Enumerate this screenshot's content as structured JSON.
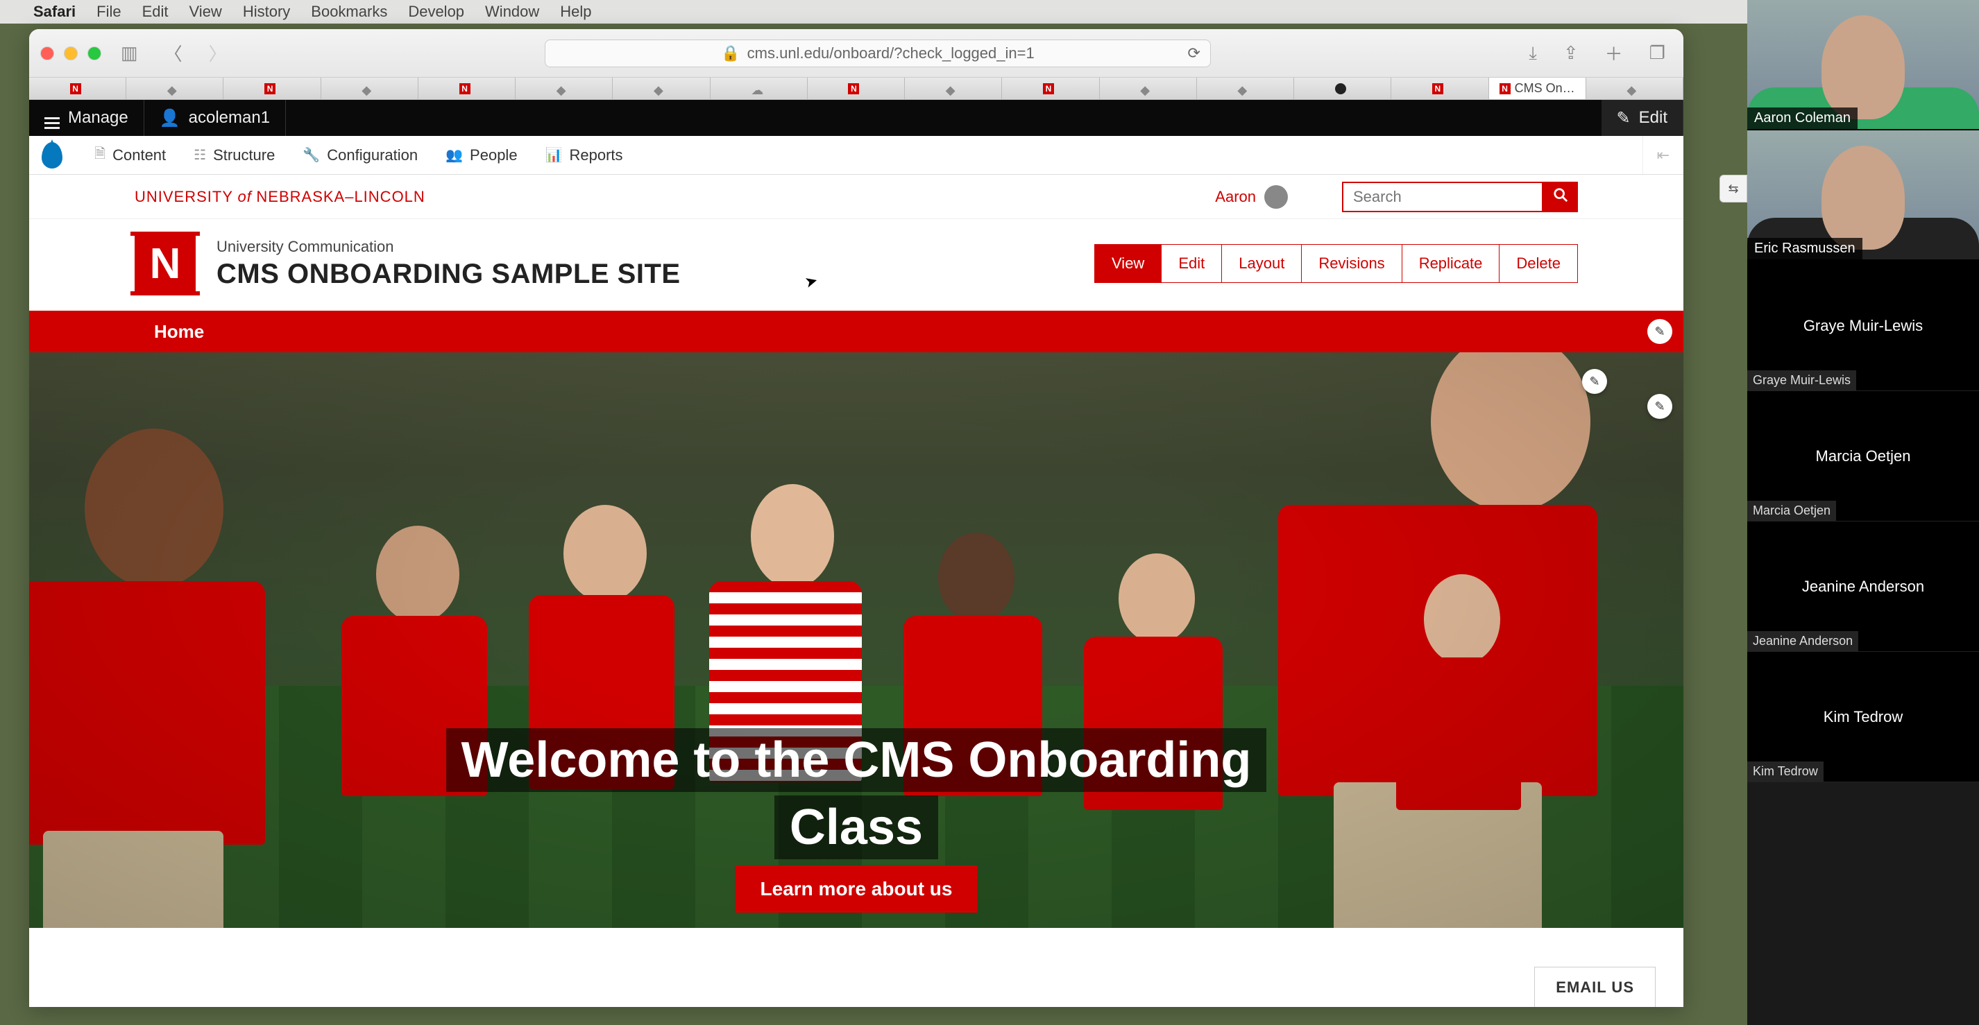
{
  "mac_menu": {
    "app": "Safari",
    "items": [
      "File",
      "Edit",
      "View",
      "History",
      "Bookmarks",
      "Develop",
      "Window",
      "Help"
    ]
  },
  "safari": {
    "url": "cms.unl.edu/onboard/?check_logged_in=1",
    "active_tab_label": "CMS On…"
  },
  "drupal_top": {
    "manage": "Manage",
    "user": "acoleman1",
    "edit": "Edit"
  },
  "drupal_sub": {
    "items": [
      "Content",
      "Structure",
      "Configuration",
      "People",
      "Reports"
    ]
  },
  "university": {
    "wordmark_pre": "UNIVERSITY",
    "wordmark_of": "of",
    "wordmark_post": "NEBRASKA–LINCOLN",
    "current_user": "Aaron",
    "search_placeholder": "Search"
  },
  "site": {
    "department": "University Communication",
    "title": "CMS ONBOARDING SAMPLE SITE",
    "logo_letter": "N"
  },
  "page_tabs": [
    "View",
    "Edit",
    "Layout",
    "Revisions",
    "Replicate",
    "Delete"
  ],
  "page_tabs_selected": "View",
  "nav": {
    "home": "Home"
  },
  "hero": {
    "title": "Welcome to the CMS Onboarding Class",
    "cta": "Learn more about us"
  },
  "footer": {
    "email_us": "EMAIL US"
  },
  "zoom": {
    "video_participants": [
      "Aaron Coleman",
      "Eric Rasmussen"
    ],
    "tiles": [
      {
        "center": "Graye Muir-Lewis",
        "tag": "Graye Muir-Lewis"
      },
      {
        "center": "Marcia Oetjen",
        "tag": "Marcia Oetjen"
      },
      {
        "center": "Jeanine Anderson",
        "tag": "Jeanine Anderson"
      },
      {
        "center": "Kim Tedrow",
        "tag": "Kim Tedrow"
      }
    ]
  },
  "colors": {
    "brand_red": "#d00000"
  }
}
